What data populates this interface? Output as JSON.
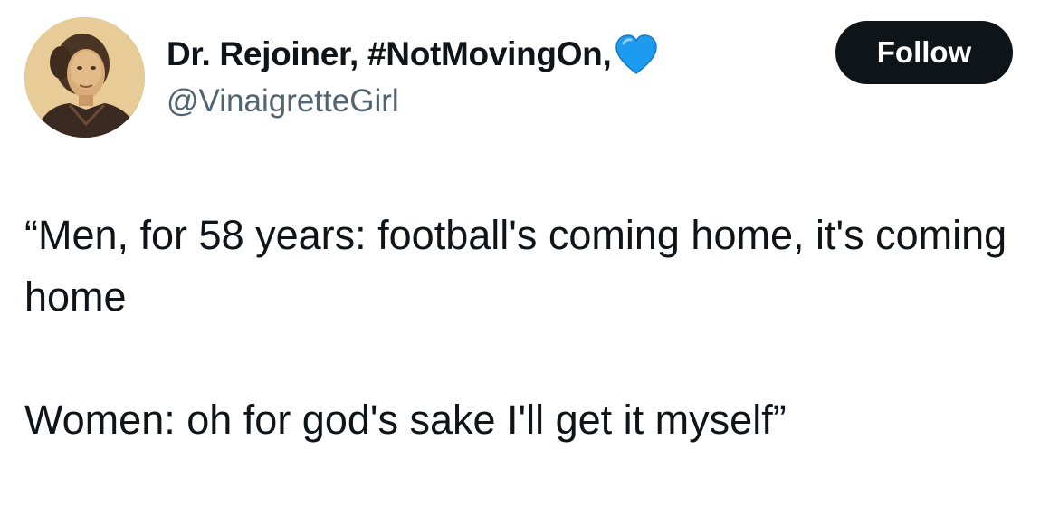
{
  "author": {
    "display_name": "Dr. Rejoiner, #NotMovingOn,",
    "badge_icon": "blue-heart-icon",
    "badge_color": "#1d9bf0",
    "handle": "@VinaigretteGirl",
    "avatar": "avatar-photo"
  },
  "actions": {
    "follow_label": "Follow"
  },
  "tweet": {
    "paragraph_1": "“Men, for 58 years: football's coming home, it's coming home",
    "paragraph_2": "Women: oh for god's sake I'll get it myself”"
  },
  "colors": {
    "text_primary": "#0f1419",
    "text_secondary": "#536471",
    "button_bg": "#0f1419",
    "button_text": "#ffffff"
  }
}
